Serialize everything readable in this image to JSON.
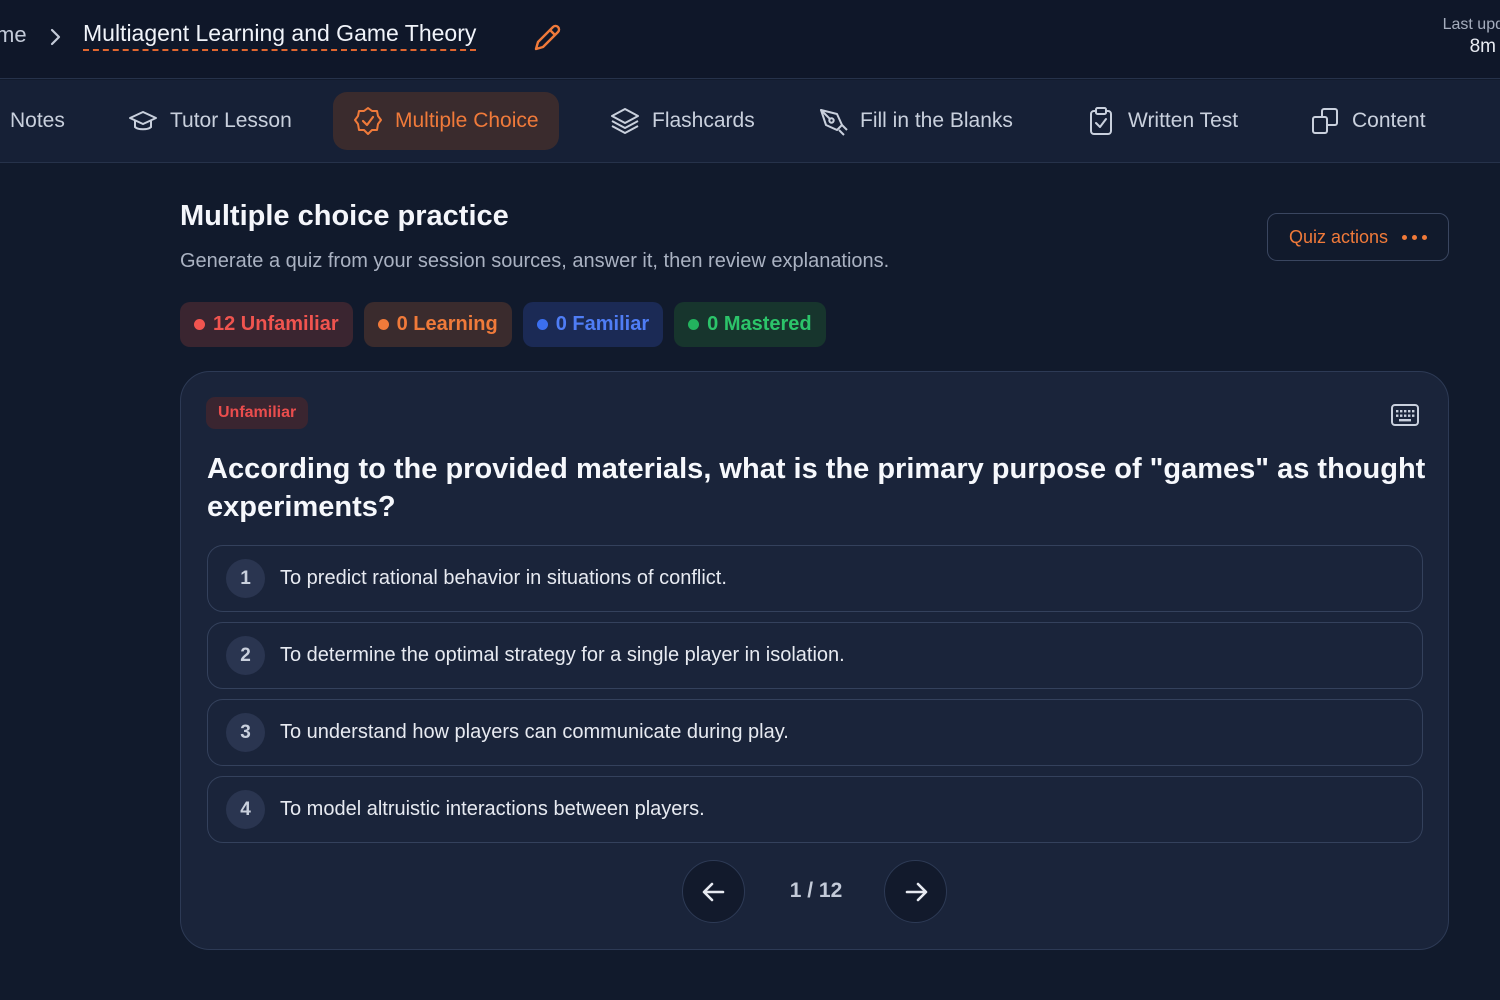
{
  "header": {
    "breadcrumb_home": "me",
    "title": "Multiagent Learning and Game Theory",
    "last_updated_label": "Last upd",
    "last_updated_value": "8m"
  },
  "tabs": [
    {
      "label": "Notes",
      "icon": "notes-icon"
    },
    {
      "label": "Tutor Lesson",
      "icon": "graduation-cap-icon"
    },
    {
      "label": "Multiple Choice",
      "icon": "check-badge-icon",
      "active": true
    },
    {
      "label": "Flashcards",
      "icon": "layers-icon"
    },
    {
      "label": "Fill in the Blanks",
      "icon": "pen-tool-icon"
    },
    {
      "label": "Written Test",
      "icon": "clipboard-check-icon"
    },
    {
      "label": "Content",
      "icon": "copy-icon"
    }
  ],
  "main": {
    "title": "Multiple choice practice",
    "subtitle": "Generate a quiz from your session sources, answer it, then review explanations.",
    "quiz_actions_label": "Quiz actions"
  },
  "chips": [
    {
      "label": "12 Unfamiliar",
      "color": "#f0544f"
    },
    {
      "label": "0 Learning",
      "color": "#f07a3a"
    },
    {
      "label": "0 Familiar",
      "color": "#4f7df5"
    },
    {
      "label": "0 Mastered",
      "color": "#2cc46a"
    }
  ],
  "card": {
    "badge": "Unfamiliar",
    "question": "According to the provided materials, what is the primary purpose of \"games\" as thought experiments?",
    "options": [
      {
        "num": "1",
        "text": "To predict rational behavior in situations of conflict."
      },
      {
        "num": "2",
        "text": "To determine the optimal strategy for a single player in isolation."
      },
      {
        "num": "3",
        "text": "To understand how players can communicate during play."
      },
      {
        "num": "4",
        "text": "To model altruistic interactions between players."
      }
    ],
    "pager": "1 / 12"
  },
  "colors": {
    "accent": "#f07a3a",
    "background": "#111a2c",
    "card": "#1a243a"
  }
}
